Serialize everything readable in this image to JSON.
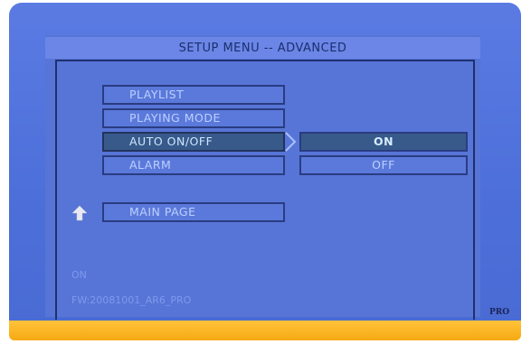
{
  "menu": {
    "title": "SETUP MENU -- ADVANCED",
    "items": [
      {
        "label": "PLAYLIST",
        "selected": false
      },
      {
        "label": "PLAYING MODE",
        "selected": false
      },
      {
        "label": "AUTO ON/OFF",
        "selected": true
      },
      {
        "label": "ALARM",
        "selected": false
      }
    ],
    "main_page_label": "MAIN PAGE"
  },
  "options": [
    {
      "label": "ON",
      "selected": true
    },
    {
      "label": "OFF",
      "selected": false
    }
  ],
  "status": {
    "value": "ON",
    "firmware": "FW:20081001_AR6_PRO"
  },
  "badge": "PRO",
  "colors": {
    "background": "#4d6fd9",
    "accent_bar": "#f6a913",
    "selected": "#385a8a"
  }
}
